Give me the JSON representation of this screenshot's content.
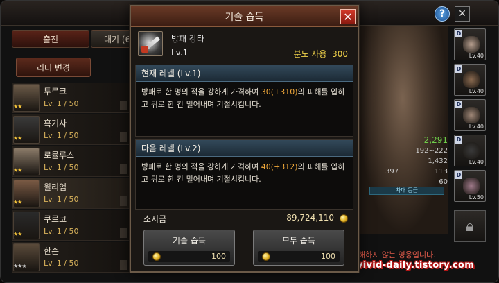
{
  "background": {
    "tabs": {
      "sortie": "출진",
      "wait": "대기 (6"
    },
    "leader_button": "리더 변경",
    "heroes": [
      {
        "name": "투르크",
        "level": "Lv. 1 / 50",
        "stars": "★★",
        "star_color": "gold",
        "portrait_color": "#6b5a48"
      },
      {
        "name": "흑기사",
        "level": "Lv. 1 / 50",
        "stars": "★★",
        "star_color": "gold",
        "portrait_color": "#3a3a3a"
      },
      {
        "name": "로뮬루스",
        "level": "Lv. 1 / 50",
        "stars": "★★",
        "star_color": "gold",
        "portrait_color": "#8a7a68"
      },
      {
        "name": "윌리엄",
        "level": "Lv. 1 / 50",
        "stars": "★★",
        "star_color": "gold",
        "portrait_color": "#7a5a44",
        "selected": true
      },
      {
        "name": "쿠로코",
        "level": "Lv. 1 / 50",
        "stars": "★★",
        "star_color": "gold",
        "portrait_color": "#2a2a2a"
      },
      {
        "name": "한손",
        "level": "Lv. 1 / 50",
        "stars": "★★★",
        "star_color": "grey",
        "portrait_color": "#5a4a3a"
      }
    ],
    "stats": {
      "power": "2,291",
      "attack": "192~222",
      "hp": "1,432",
      "def_left": "397",
      "def_right": "113",
      "speed": "60"
    },
    "grade_bar": "차대 등급",
    "gear": [
      {
        "grade": "D",
        "level": "Lv.40",
        "color": "#b8a090"
      },
      {
        "grade": "D",
        "level": "Lv.40",
        "color": "#8a6a50"
      },
      {
        "grade": "D",
        "level": "Lv.40",
        "color": "#a08878"
      },
      {
        "grade": "D",
        "level": "Lv.40",
        "color": "#3a3a3a"
      },
      {
        "grade": "D",
        "level": "Lv.50",
        "color": "#a07a8a"
      }
    ],
    "bottom_notice": "해하지 않는 영웅입니다.",
    "watermark": "vivid-daily.tistory.com",
    "help_glyph": "?",
    "close_glyph": "✕"
  },
  "modal": {
    "title": "기술 습득",
    "close_glyph": "✕",
    "skill": {
      "name": "방패 강타",
      "level": "Lv.1",
      "rage_label": "분노 사용",
      "rage_value": "300"
    },
    "current": {
      "header": "현재 레벨 (Lv.1)",
      "desc_pre": "방패로 한 명의 적을 강하게 가격하여 ",
      "desc_hl": "30(+310)",
      "desc_post": "의 피해를 입히고 뒤로 한 칸 밀어내며 기절시킵니다."
    },
    "next": {
      "header": "다음 레벨 (Lv.2)",
      "desc_pre": "방패로 한 명의 적을 강하게 가격하여 ",
      "desc_hl": "40(+312)",
      "desc_post": "의 피해를 입히고 뒤로 한 칸 밀어내며 기절시킵니다."
    },
    "gold": {
      "label": "소지금",
      "amount": "89,724,110"
    },
    "buttons": {
      "learn": {
        "label": "기술 습득",
        "cost": "100"
      },
      "learn_all": {
        "label": "모두 습득",
        "cost": "100"
      }
    }
  }
}
